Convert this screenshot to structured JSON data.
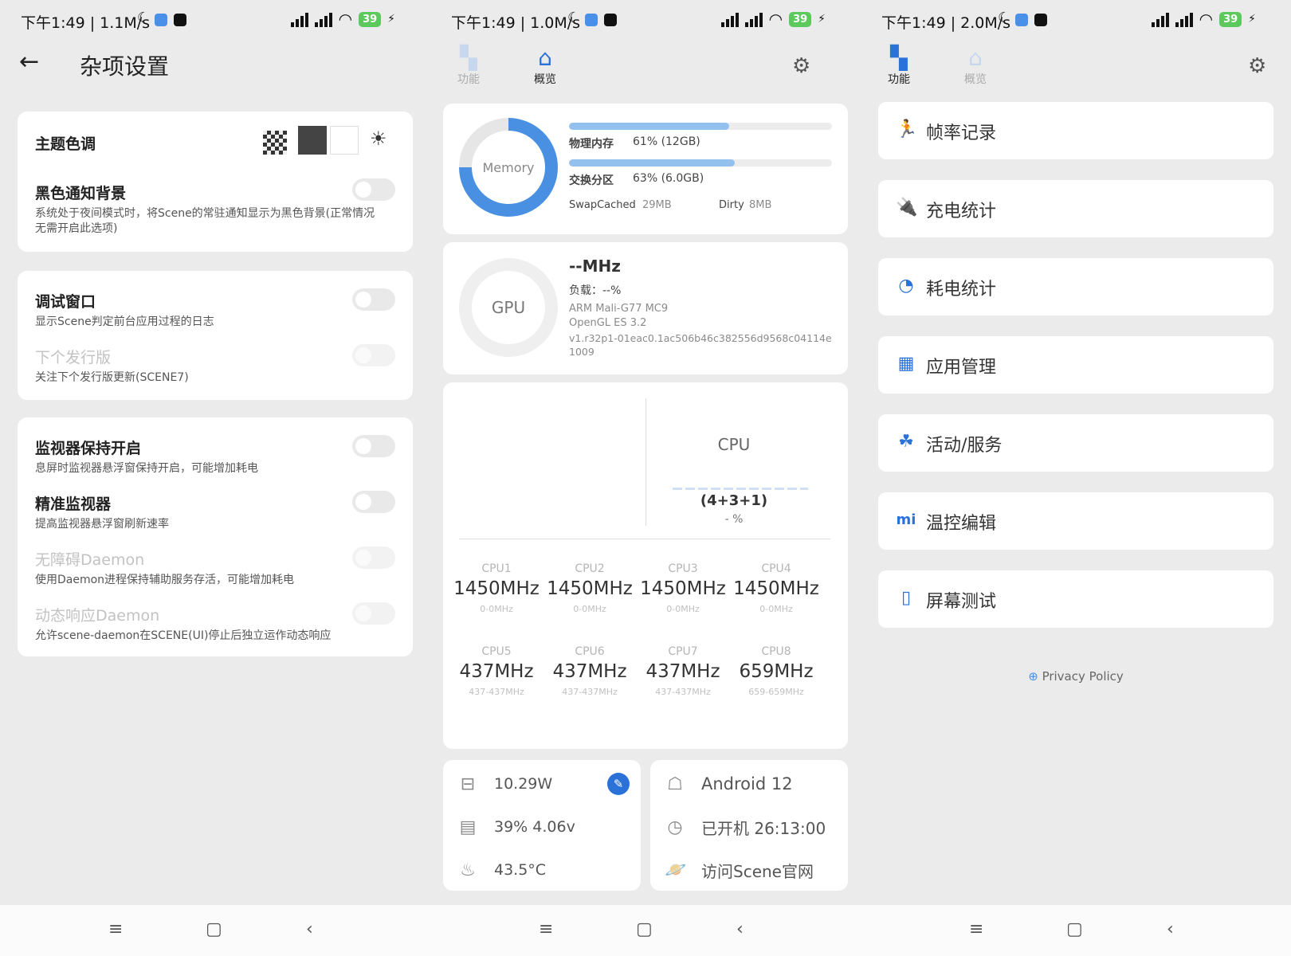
{
  "screens": [
    {
      "status": {
        "time": "下午1:49 | 1.1M/s",
        "battery": "39"
      },
      "title": "杂项设置",
      "theme": {
        "label": "主题色调"
      },
      "black_notify": {
        "title": "黑色通知背景",
        "desc": "系统处于夜间模式时，将Scene的常驻通知显示为黑色背景(正常情况无需开启此选项)"
      },
      "debug_window": {
        "title": "调试窗口",
        "desc": "显示Scene判定前台应用过程的日志"
      },
      "next_release": {
        "title": "下个发行版",
        "desc": "关注下个发行版更新(SCENE7)"
      },
      "monitor_keep": {
        "title": "监视器保持开启",
        "desc": "息屏时监视器悬浮窗保持开启，可能增加耗电"
      },
      "precise_monitor": {
        "title": "精准监视器",
        "desc": "提高监视器悬浮窗刷新速率"
      },
      "a11y_daemon": {
        "title": "无障碍Daemon",
        "desc": "使用Daemon进程保持辅助服务存活，可能增加耗电"
      },
      "dyn_daemon": {
        "title": "动态响应Daemon",
        "desc": "允许scene-daemon在SCENE(UI)停止后独立运作动态响应"
      }
    },
    {
      "status": {
        "time": "下午1:49 | 1.0M/s",
        "battery": "39"
      },
      "tabs": [
        "功能",
        "概览"
      ],
      "memory": {
        "label": "Memory",
        "physical_label": "物理内存",
        "physical_value": "61% (12GB)",
        "physical_pct": 61,
        "swap_label": "交换分区",
        "swap_value": "63% (6.0GB)",
        "swap_pct": 63,
        "swapcached_label": "SwapCached",
        "swapcached_value": "29MB",
        "dirty_label": "Dirty",
        "dirty_value": "8MB",
        "ring_pct": 75
      },
      "gpu": {
        "label": "GPU",
        "freq": "--MHz",
        "load": "负载：--%",
        "model": "ARM Mali-G77 MC9",
        "api": "OpenGL ES 3.2",
        "driver": "v1.r32p1-01eac0.1ac506b46c382556d9568c04114e1009"
      },
      "cpu": {
        "label": "CPU",
        "cluster": "(4+3+1)",
        "load": "- %",
        "cores": [
          {
            "name": "CPU1",
            "freq": "1450MHz",
            "range": "0-0MHz"
          },
          {
            "name": "CPU2",
            "freq": "1450MHz",
            "range": "0-0MHz"
          },
          {
            "name": "CPU3",
            "freq": "1450MHz",
            "range": "0-0MHz"
          },
          {
            "name": "CPU4",
            "freq": "1450MHz",
            "range": "0-0MHz"
          },
          {
            "name": "CPU5",
            "freq": "437MHz",
            "range": "437-437MHz"
          },
          {
            "name": "CPU6",
            "freq": "437MHz",
            "range": "437-437MHz"
          },
          {
            "name": "CPU7",
            "freq": "437MHz",
            "range": "437-437MHz"
          },
          {
            "name": "CPU8",
            "freq": "659MHz",
            "range": "659-659MHz"
          }
        ]
      },
      "battery_card": {
        "power": "10.29W",
        "level": "39%  4.06v",
        "temp": "43.5°C"
      },
      "device_card": {
        "android": "Android 12",
        "uptime": "已开机  26:13:00",
        "website": "访问Scene官网"
      }
    },
    {
      "status": {
        "time": "下午1:49 | 2.0M/s",
        "battery": "39"
      },
      "tabs": [
        "功能",
        "概览"
      ],
      "features": [
        {
          "label": "帧率记录",
          "icon": "running-icon"
        },
        {
          "label": "充电统计",
          "icon": "charger-icon"
        },
        {
          "label": "耗电统计",
          "icon": "pie-chart-icon"
        },
        {
          "label": "应用管理",
          "icon": "grid-icon"
        },
        {
          "label": "活动/服务",
          "icon": "circles-icon"
        },
        {
          "label": "温控编辑",
          "icon": "mi-icon"
        },
        {
          "label": "屏幕测试",
          "icon": "tablet-icon"
        }
      ],
      "privacy": "Privacy Policy"
    }
  ],
  "colors": {
    "accent": "#2a72d8",
    "bar": "#93c1ee",
    "ring": "#4a90e2"
  }
}
